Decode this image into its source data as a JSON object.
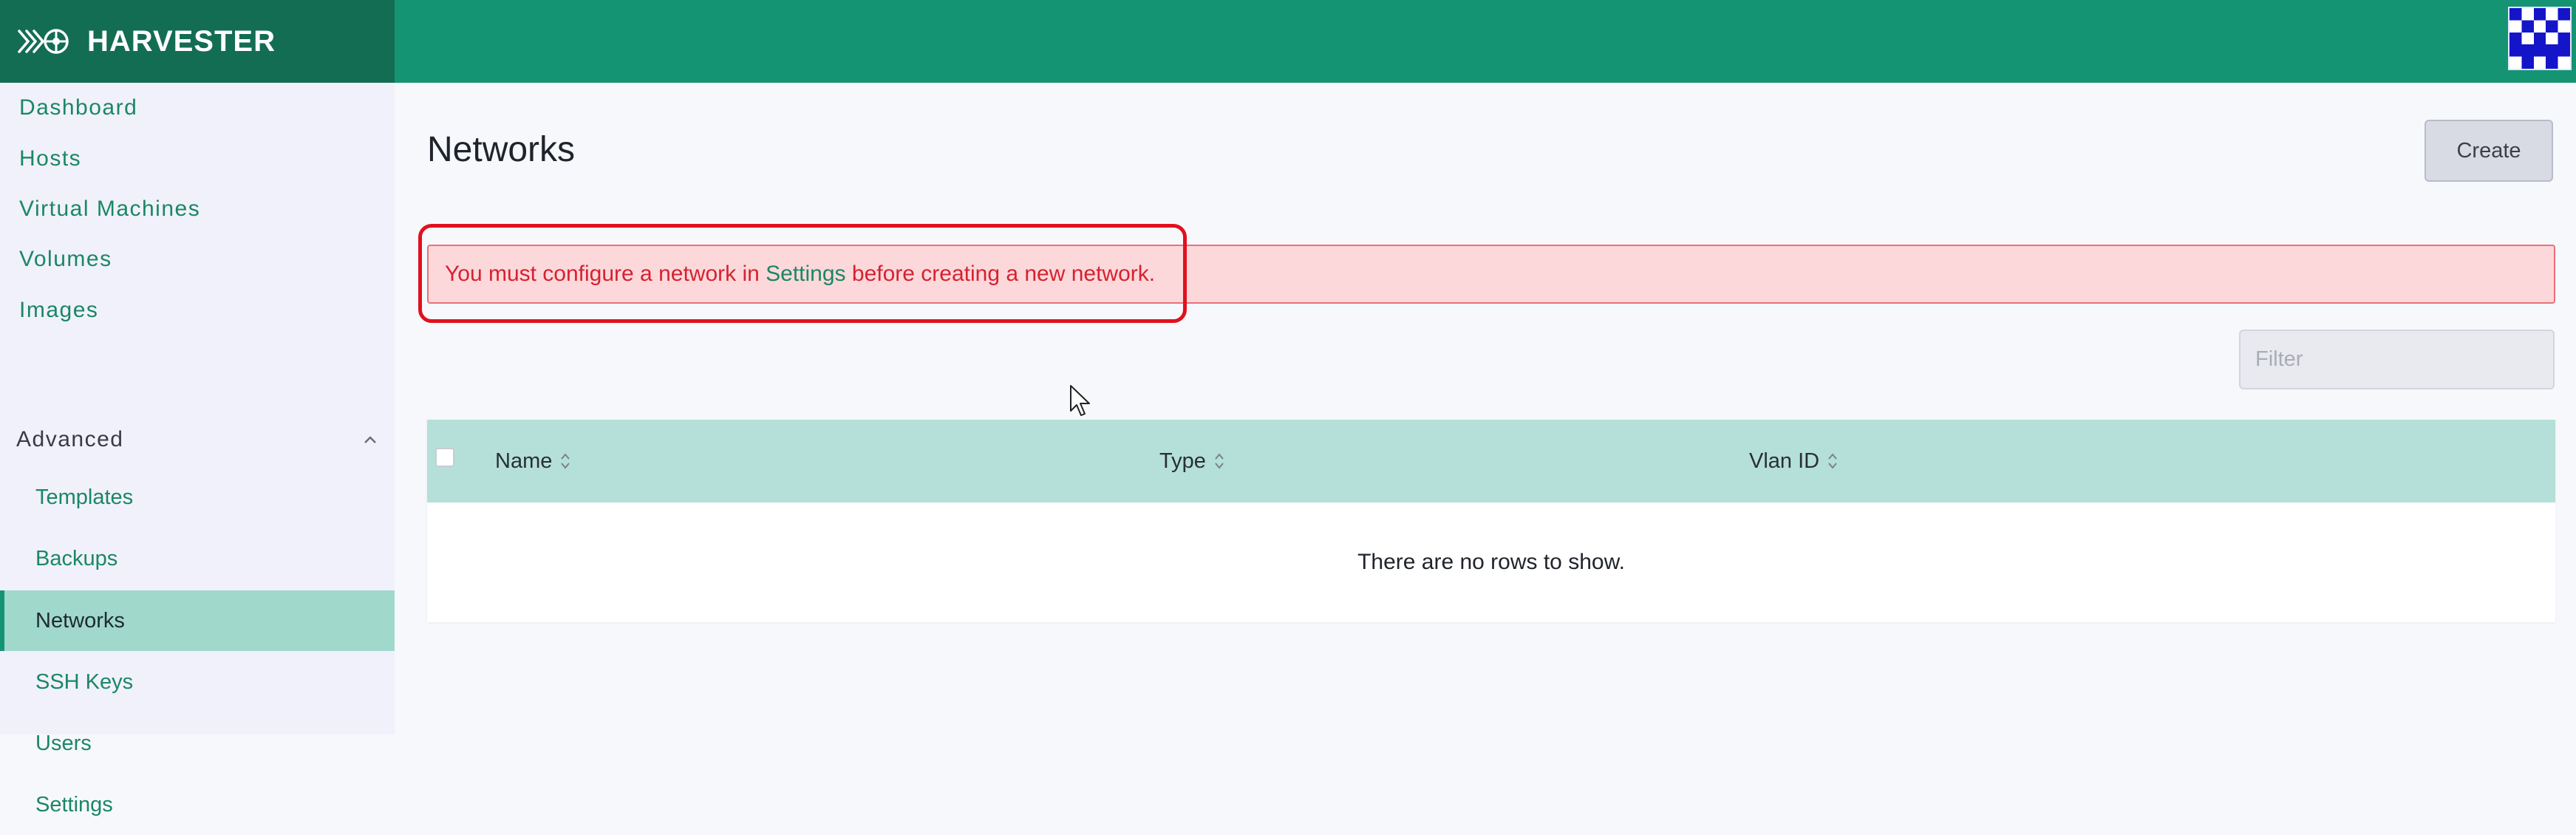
{
  "header": {
    "brand_name": "HARVESTER",
    "brand_icon": "harvester-logo-icon",
    "avatar_icon": "user-avatar-icon"
  },
  "sidebar": {
    "items": [
      {
        "label": "Dashboard"
      },
      {
        "label": "Hosts"
      },
      {
        "label": "Virtual Machines"
      },
      {
        "label": "Volumes"
      },
      {
        "label": "Images"
      }
    ],
    "group": {
      "label": "Advanced",
      "expanded": true,
      "items": [
        {
          "label": "Templates"
        },
        {
          "label": "Backups"
        },
        {
          "label": "Networks",
          "active": true
        },
        {
          "label": "SSH Keys"
        },
        {
          "label": "Users"
        },
        {
          "label": "Settings"
        }
      ]
    }
  },
  "main": {
    "title": "Networks",
    "create_label": "Create",
    "banner": {
      "prefix": "You must configure a network in ",
      "link": "Settings",
      "suffix": " before creating a new network."
    },
    "filter_placeholder": "Filter",
    "table": {
      "columns": [
        {
          "label": "Name"
        },
        {
          "label": "Type"
        },
        {
          "label": "Vlan ID"
        }
      ],
      "empty_text": "There are no rows to show."
    }
  },
  "colors": {
    "brand_green": "#159473",
    "brand_dark": "#136d53",
    "link_green": "#1a8765",
    "error_text": "#d7212f",
    "error_bg": "#fcd8db",
    "table_header": "#b4e0d9",
    "active_nav": "#a0d8cc"
  }
}
